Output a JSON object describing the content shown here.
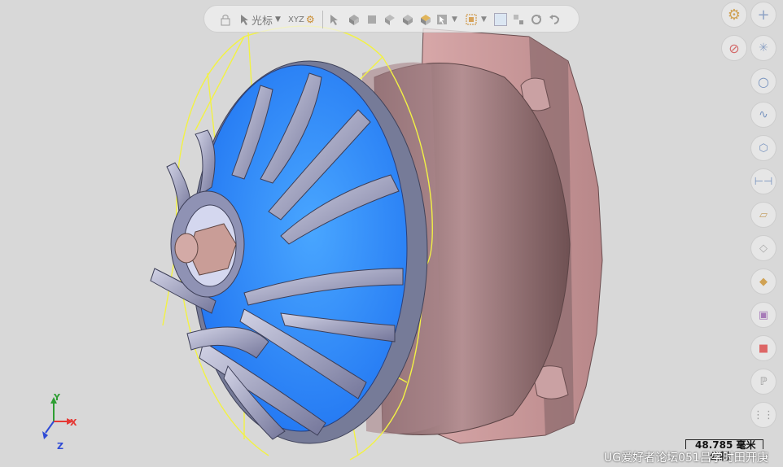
{
  "toolbar": {
    "cursor_label": "光标",
    "coords_label": "XYZ"
  },
  "scale_bar": {
    "value": "48.785 毫米",
    "unit": "公制"
  },
  "triad": {
    "x": "X",
    "y": "Y",
    "z": "Z"
  },
  "watermark": "UG爱好者论坛051吕学时田开庚",
  "colors": {
    "background": "#d8d8d8",
    "impeller_face": "#2f86ff",
    "blade": "#a7a9c8",
    "housing": "#9f7b7e",
    "flange": "#d7a7a8",
    "highlight": "#ffff33",
    "axis_x": "#e53935",
    "axis_y": "#2e9e33",
    "axis_z": "#2f4bd6"
  }
}
